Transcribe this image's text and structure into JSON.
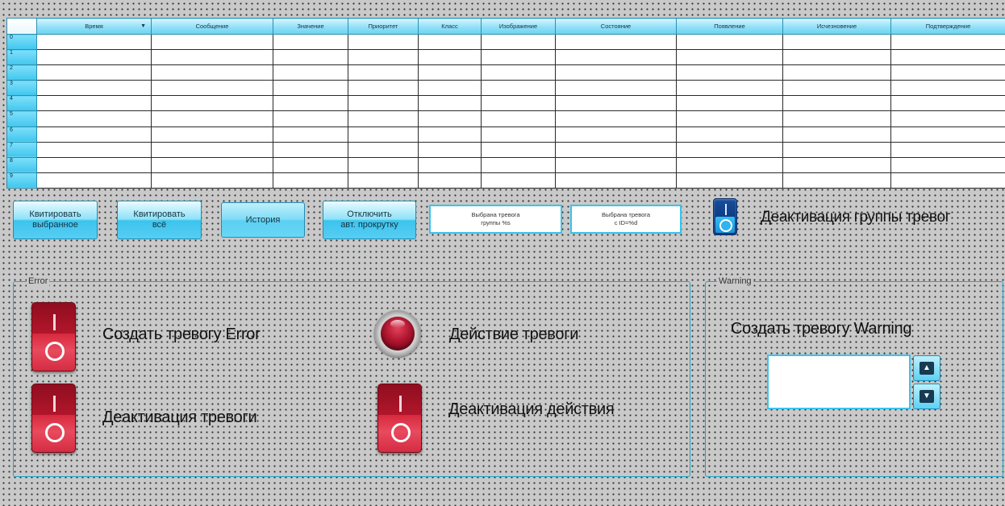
{
  "table": {
    "columns": [
      "Время",
      "Сообщение",
      "Значение",
      "Приоритет",
      "Класс",
      "Изображение",
      "Состояние",
      "Появление",
      "Исчезновение",
      "Подтверждение"
    ],
    "sort_icon": "sort-down-triangle-icon",
    "row_numbers": [
      "0",
      "1",
      "2",
      "3",
      "4",
      "5",
      "6",
      "7",
      "8",
      "9"
    ]
  },
  "buttons": {
    "ack_selected": "Квитировать\nвыбранное",
    "ack_all": "Квитировать\nвсё",
    "history": "История",
    "disable_scroll": "Отключить\nавт. прокрутку"
  },
  "info": {
    "selected_group": "Выбрана тревога\nгруппы %s",
    "selected_id": "Выбрана тревога\nс ID=%d"
  },
  "group_deactivation": {
    "label": "Деактивация группы тревог"
  },
  "error_group": {
    "title": "Error",
    "create_alarm_label": "Создать тревогу Error",
    "deactivate_alarm_label": "Деактивация тревоги",
    "alarm_action_label": "Действие тревоги",
    "deactivate_action_label": "Деактивация действия"
  },
  "warning_group": {
    "title": "Warning",
    "create_alarm_label": "Создать тревогу Warning",
    "value": ""
  },
  "colors": {
    "accent": "#39c3ec",
    "switch_red": "#d32237",
    "switch_blue": "#0d3a82",
    "background": "#c9c9c9"
  }
}
